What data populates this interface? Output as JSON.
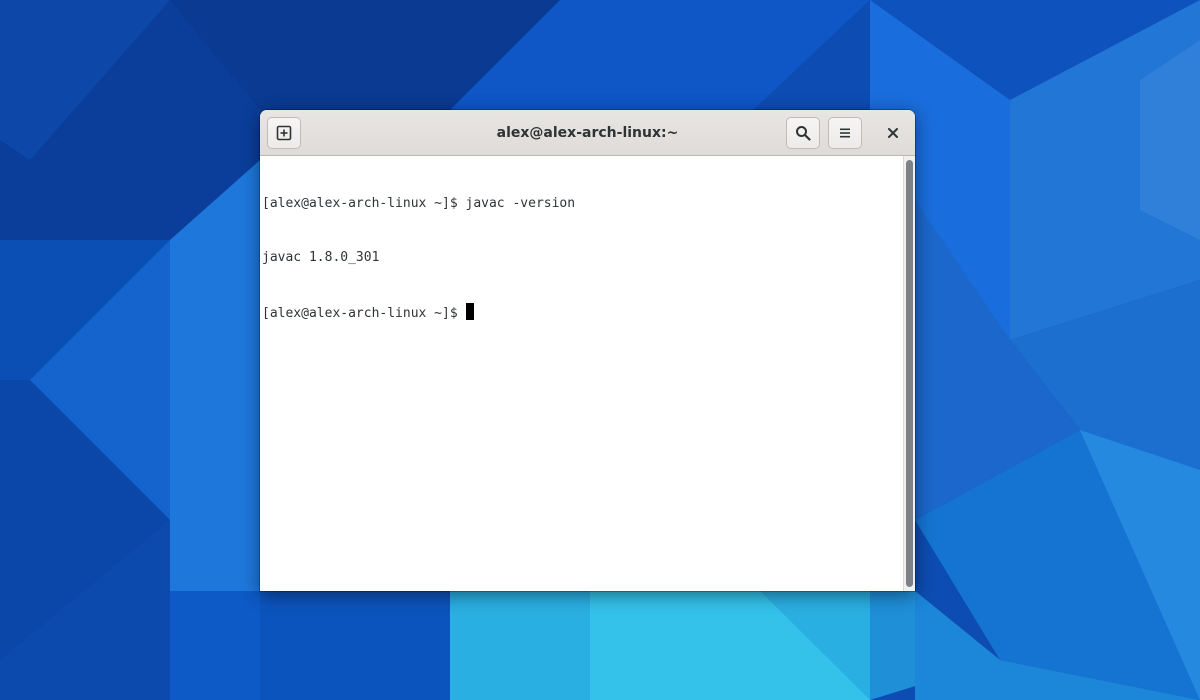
{
  "window": {
    "title": "alex@alex-arch-linux:~"
  },
  "headerbar": {
    "icons": [
      "new-tab-icon",
      "search-icon",
      "hamburger-menu-icon",
      "close-icon"
    ]
  },
  "terminal": {
    "lines": [
      {
        "prompt": "[alex@alex-arch-linux ~]$",
        "command": " javac -version"
      },
      {
        "output": "javac 1.8.0_301"
      },
      {
        "prompt": "[alex@alex-arch-linux ~]$",
        "command": ""
      }
    ]
  },
  "colors": {
    "wallpaper_dark": "#0b3f99",
    "wallpaper_light": "#27b6e6",
    "headerbar": "#e3e0dd",
    "terminal_bg": "#ffffff",
    "terminal_fg": "#2e3436",
    "scroll_thumb": "#7e8087"
  }
}
